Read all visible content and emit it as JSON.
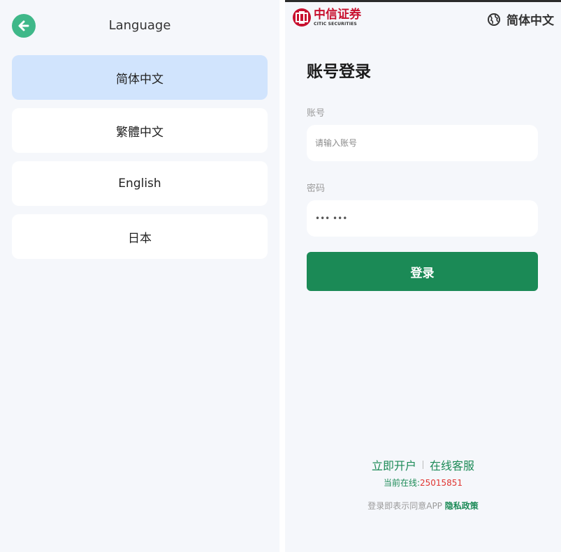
{
  "language_panel": {
    "title": "Language",
    "options": [
      {
        "label": "简体中文",
        "selected": true
      },
      {
        "label": "繁體中文",
        "selected": false
      },
      {
        "label": "English",
        "selected": false
      },
      {
        "label": "日本",
        "selected": false
      }
    ]
  },
  "login_panel": {
    "brand": {
      "cn": "中信证券",
      "en": "CITIC SECURITIES"
    },
    "language_switch": "简体中文",
    "heading": "账号登录",
    "account": {
      "label": "账号",
      "placeholder": "请输入账号"
    },
    "password": {
      "label": "密码",
      "value": "••• •••"
    },
    "login_button": "登录",
    "links": {
      "open_account": "立即开户",
      "service": "在线客服"
    },
    "online": {
      "label": "当前在线:",
      "count": "25015851"
    },
    "agreement": {
      "text": "登录即表示同意APP",
      "policy": "隐私政策"
    }
  },
  "colors": {
    "accent": "#1b8a56",
    "back_button": "#3fb889",
    "selected_option": "#d1e4fd",
    "brand_red": "#c8102e",
    "count_red": "#e0332f"
  }
}
